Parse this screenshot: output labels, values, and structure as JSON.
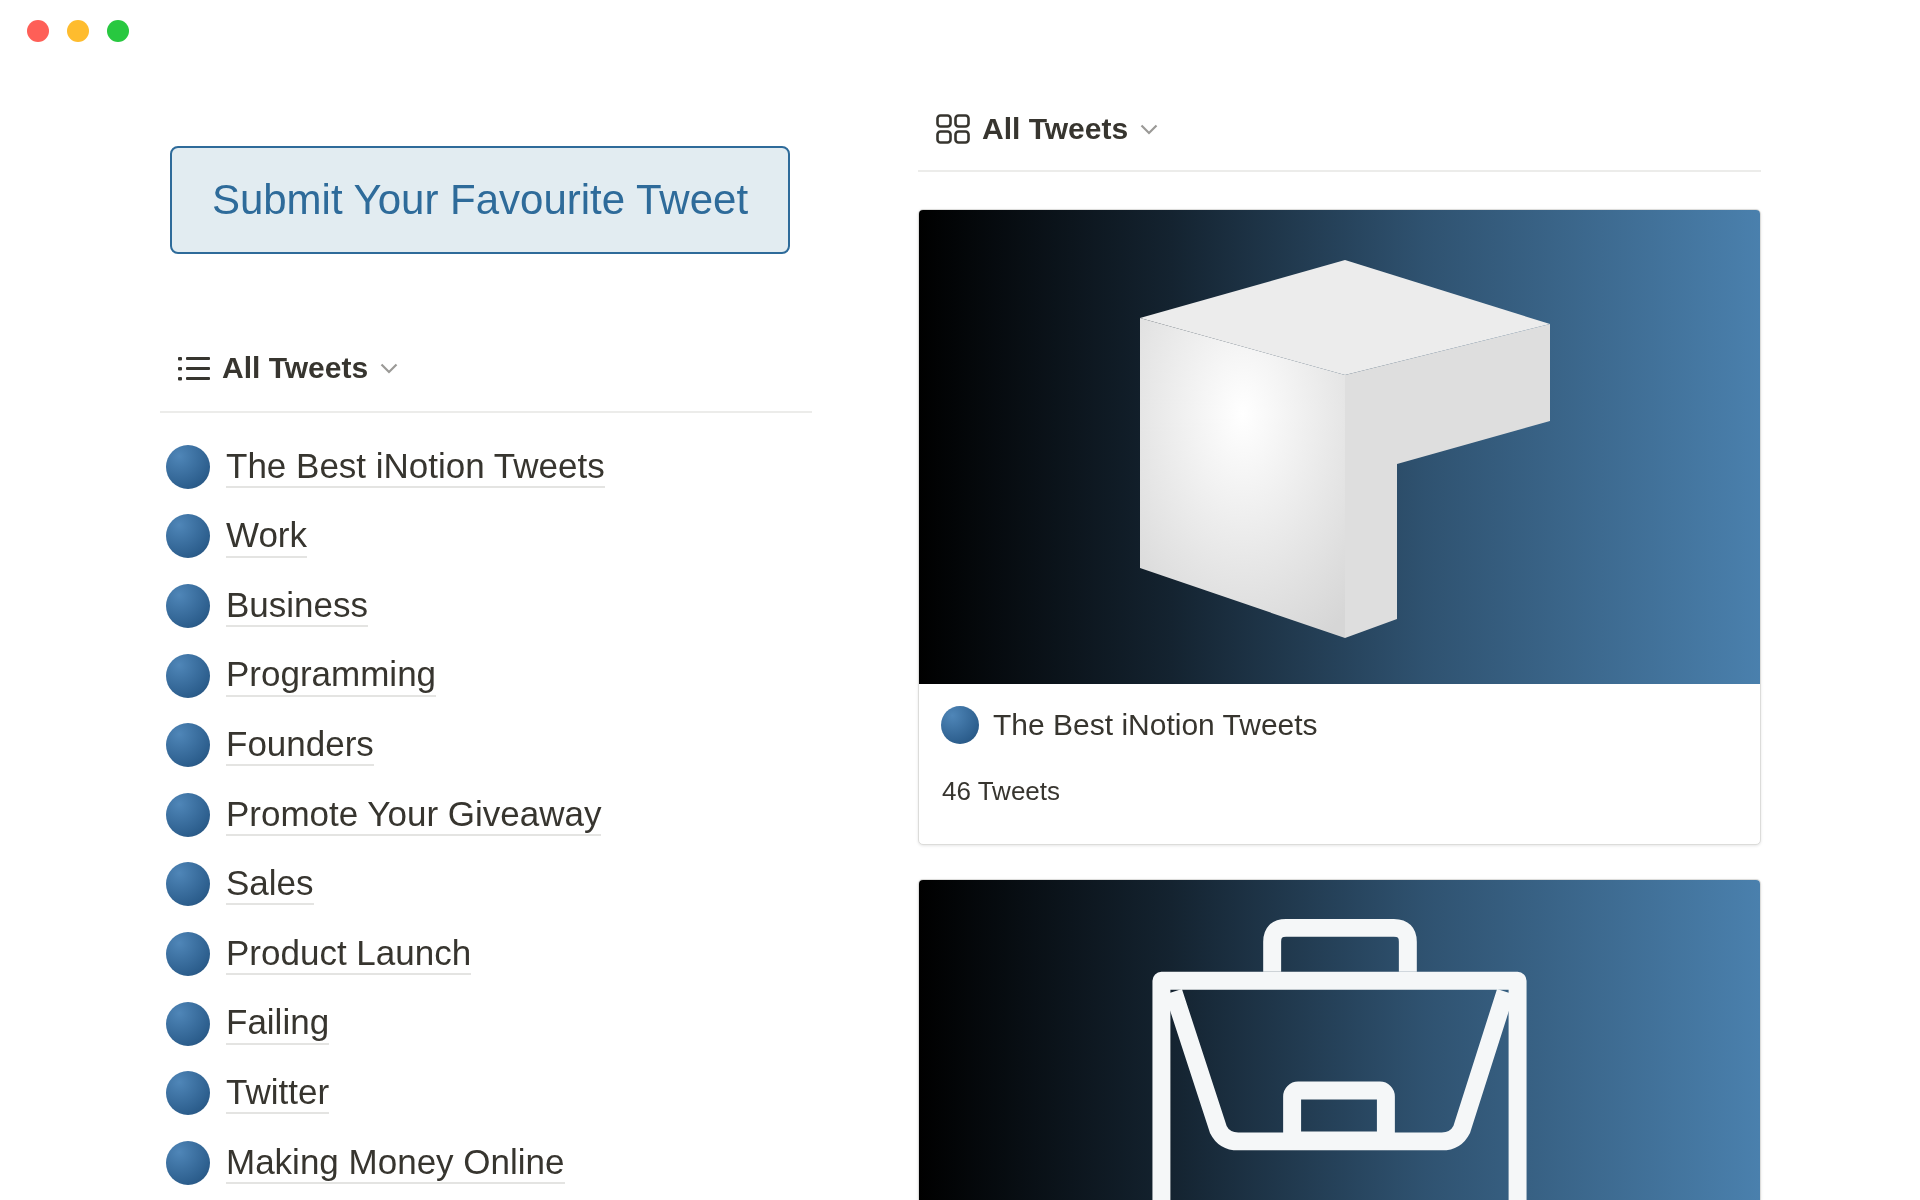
{
  "window": {
    "controls": [
      {
        "color": "#fe5f57"
      },
      {
        "color": "#febc2e"
      },
      {
        "color": "#28c840"
      }
    ]
  },
  "submit_button": {
    "label": "Submit Your Favourite Tweet"
  },
  "list_view": {
    "title": "All Tweets",
    "items": [
      {
        "label": "The Best iNotion Tweets"
      },
      {
        "label": "Work"
      },
      {
        "label": "Business"
      },
      {
        "label": "Programming"
      },
      {
        "label": "Founders"
      },
      {
        "label": "Promote Your Giveaway"
      },
      {
        "label": "Sales"
      },
      {
        "label": "Product Launch"
      },
      {
        "label": "Failing"
      },
      {
        "label": "Twitter"
      },
      {
        "label": "Making Money Online"
      }
    ]
  },
  "gallery_view": {
    "title": "All Tweets",
    "cards": [
      {
        "kind": "cube",
        "title": "The Best iNotion Tweets",
        "count": "46 Tweets"
      },
      {
        "kind": "briefcase"
      }
    ]
  }
}
